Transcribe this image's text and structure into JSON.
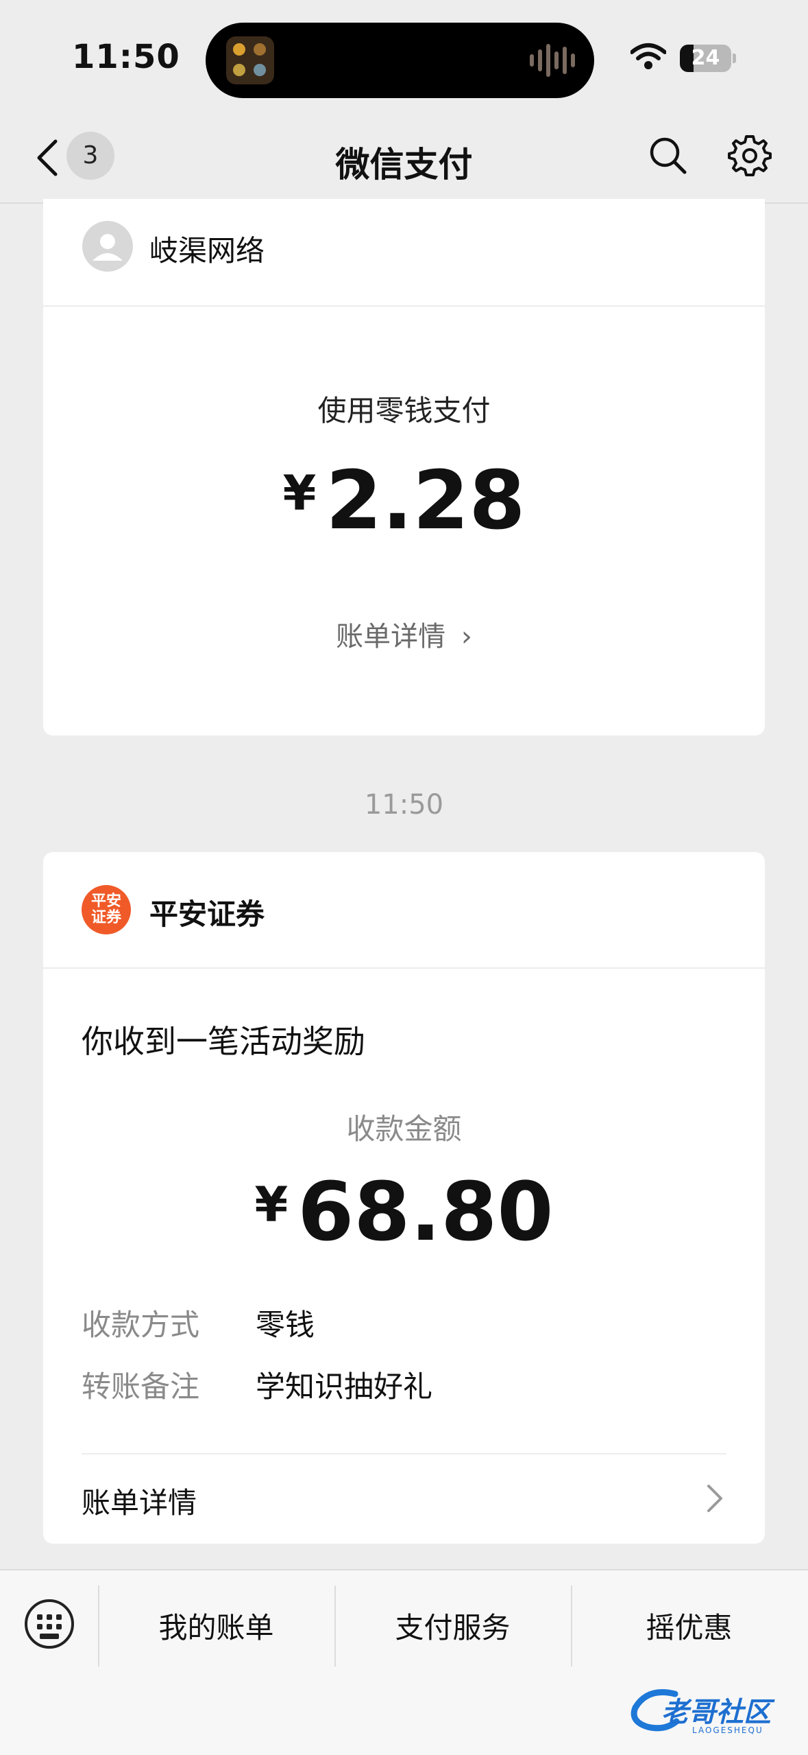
{
  "status": {
    "time": "11:50",
    "battery": "24"
  },
  "nav": {
    "badge_count": "3",
    "title": "微信支付"
  },
  "card1": {
    "merchant": "岐渠网络",
    "pay_method": "使用零钱支付",
    "currency": "¥",
    "amount": "2.28",
    "bill_link": "账单详情",
    "chevron": "›"
  },
  "timestamp": "11:50",
  "card2": {
    "merchant": "平安证券",
    "logo_text_line1": "平安",
    "logo_text_line2": "证券",
    "headline": "你收到一笔活动奖励",
    "amount_label": "收款金额",
    "currency": "¥",
    "amount": "68.80",
    "rows": [
      {
        "label": "收款方式",
        "value": "零钱"
      },
      {
        "label": "转账备注",
        "value": "学知识抽好礼"
      }
    ],
    "bill_details": "账单详情"
  },
  "bottom_menu": {
    "items": [
      "我的账单",
      "支付服务",
      "摇优惠"
    ]
  },
  "watermark": {
    "text": "老哥社区",
    "sub": "LAOGESHEQU"
  },
  "colors": {
    "brand_orange": "#f05a28",
    "background": "#ededed"
  }
}
